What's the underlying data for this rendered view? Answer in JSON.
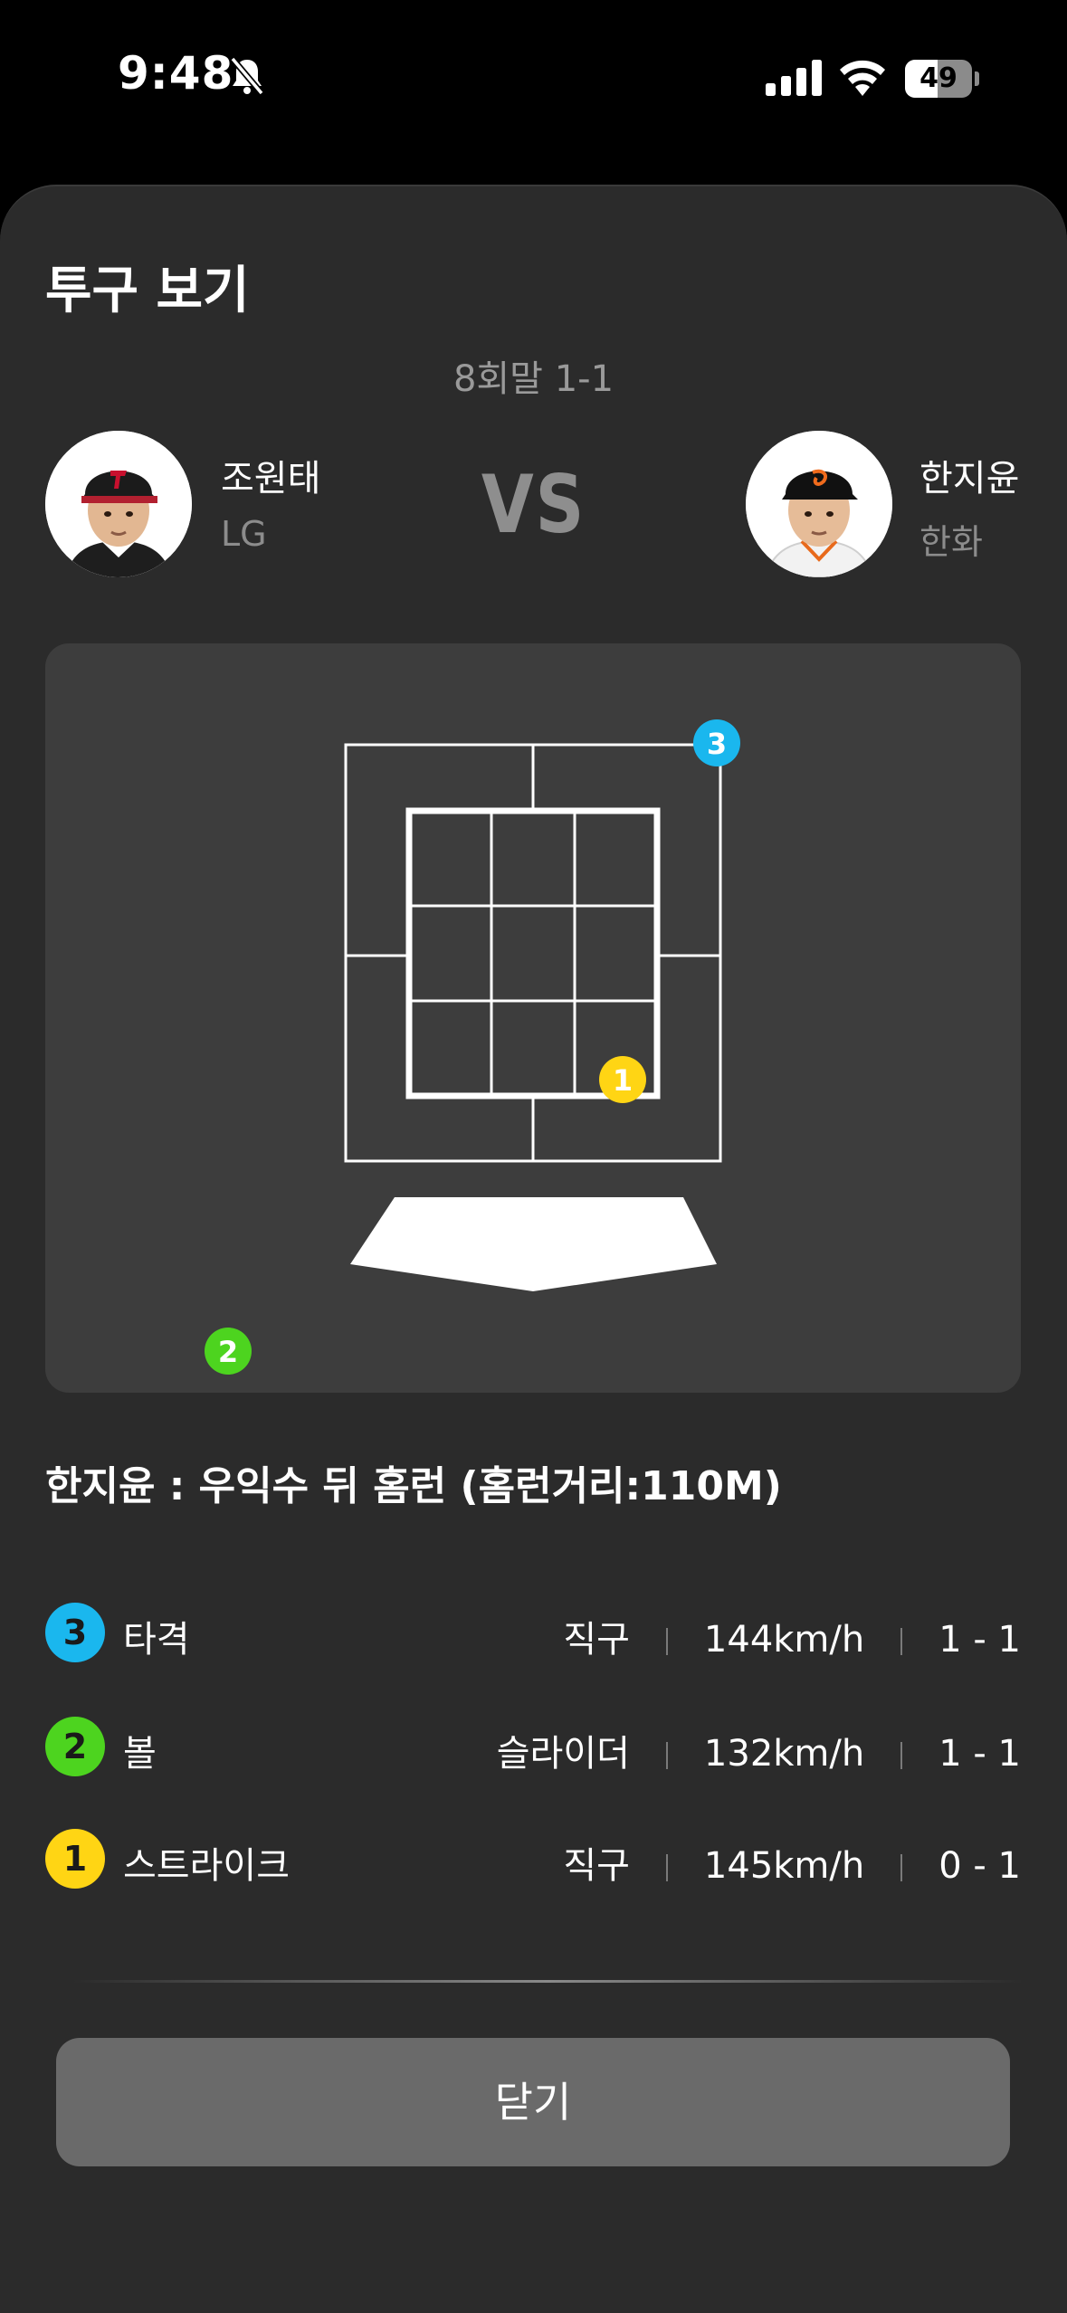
{
  "status_bar": {
    "time": "9:48",
    "battery": "49",
    "battery_level": 0.49,
    "icons": [
      "bell-muted-icon",
      "signal-icon",
      "wifi-icon",
      "battery-icon"
    ]
  },
  "sheet": {
    "title": "투구 보기",
    "inning": "8회말 1-1"
  },
  "batter": {
    "name": "조원태",
    "team": "LG"
  },
  "vs_label": "VS",
  "pitcher": {
    "name": "한지윤",
    "team": "한화"
  },
  "zone": {
    "markers": [
      {
        "number": "3",
        "color": "#1ab7ee"
      },
      {
        "number": "1",
        "color": "#ffd514"
      },
      {
        "number": "2",
        "color": "#4dd41f"
      }
    ]
  },
  "result_text": "한지윤 : 우익수 뒤 홈런 (홈런거리:110M)",
  "pitches": [
    {
      "number": "3",
      "color": "#1ab7ee",
      "result": "타격",
      "type": "직구",
      "speed": "144km/h",
      "count": "1 - 1"
    },
    {
      "number": "2",
      "color": "#4dd41f",
      "result": "볼",
      "type": "슬라이더",
      "speed": "132km/h",
      "count": "1 - 1"
    },
    {
      "number": "1",
      "color": "#ffd514",
      "result": "스트라이크",
      "type": "직구",
      "speed": "145km/h",
      "count": "0 - 1"
    }
  ],
  "close_label": "닫기"
}
